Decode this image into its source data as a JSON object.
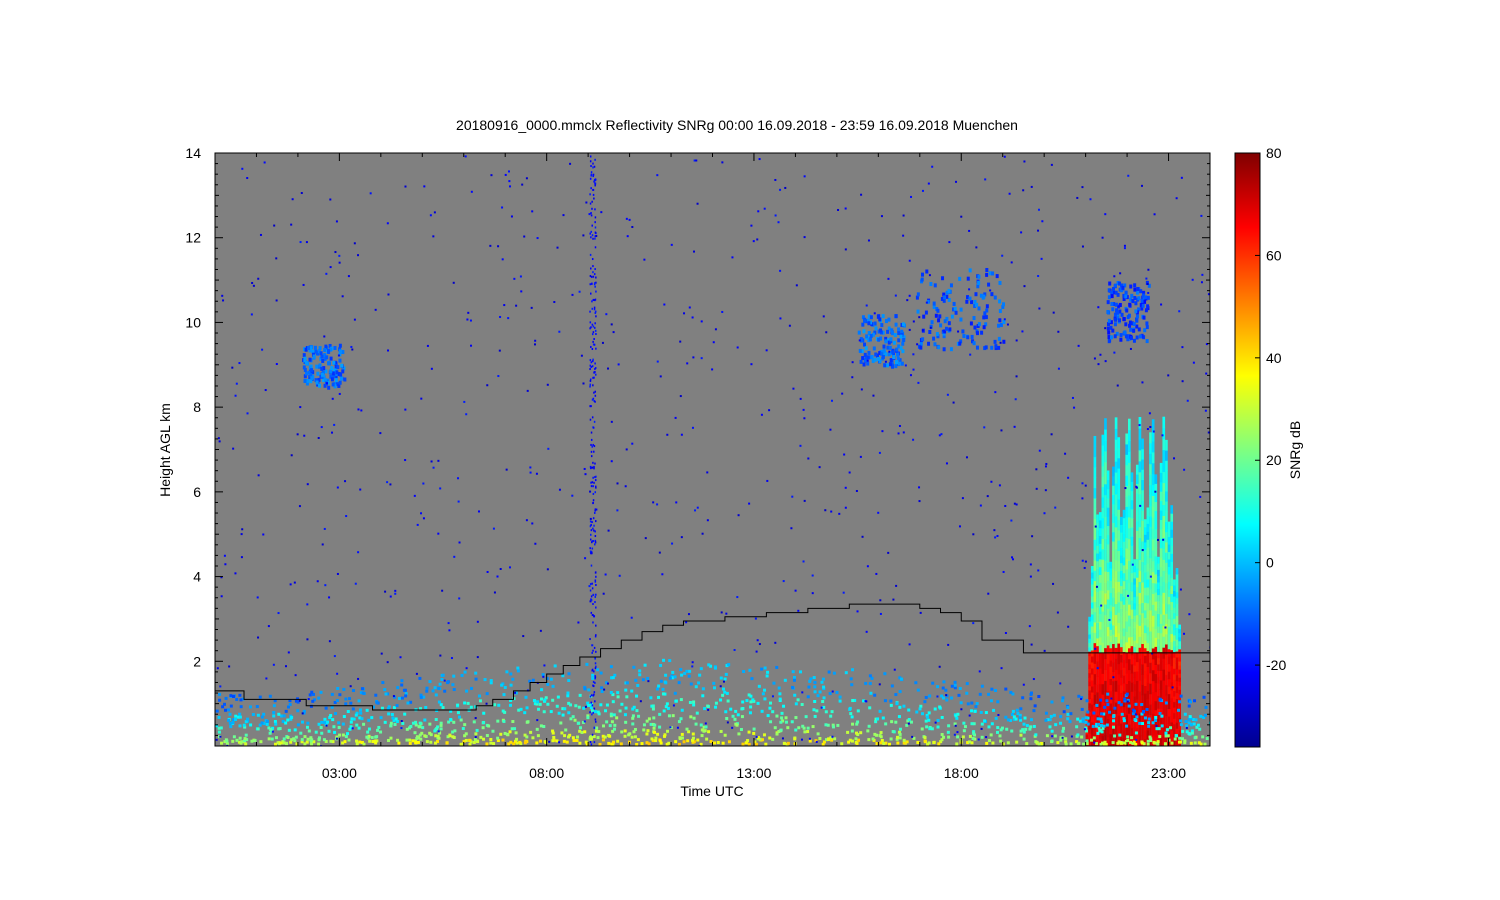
{
  "chart_data": {
    "type": "heatmap",
    "title": "20180916_0000.mmclx Reflectivity SNRg   00:00 16.09.2018 - 23:59 16.09.2018 Muenchen",
    "xlabel": "Time UTC",
    "ylabel": "Height AGL km",
    "x_range_hours": [
      0,
      24
    ],
    "ylim": [
      0,
      14
    ],
    "x_ticks": [
      {
        "hours": 3,
        "label": "03:00"
      },
      {
        "hours": 8,
        "label": "08:00"
      },
      {
        "hours": 13,
        "label": "13:00"
      },
      {
        "hours": 18,
        "label": "18:00"
      },
      {
        "hours": 23,
        "label": "23:00"
      }
    ],
    "y_ticks": [
      2,
      4,
      6,
      8,
      10,
      12,
      14
    ],
    "background_color": "#808080",
    "colorbar": {
      "label": "SNRg dB",
      "range": [
        -36,
        80
      ],
      "ticks": [
        -20,
        0,
        20,
        40,
        60,
        80
      ],
      "colormap": "jet"
    },
    "black_line_km": [
      [
        0.0,
        1.3
      ],
      [
        0.7,
        1.1
      ],
      [
        2.2,
        0.95
      ],
      [
        3.8,
        0.85
      ],
      [
        6.3,
        0.95
      ],
      [
        6.7,
        1.1
      ],
      [
        7.2,
        1.3
      ],
      [
        7.6,
        1.5
      ],
      [
        8.0,
        1.7
      ],
      [
        8.4,
        1.9
      ],
      [
        8.8,
        2.1
      ],
      [
        9.3,
        2.3
      ],
      [
        9.8,
        2.5
      ],
      [
        10.3,
        2.7
      ],
      [
        10.8,
        2.85
      ],
      [
        11.3,
        2.95
      ],
      [
        12.3,
        3.05
      ],
      [
        13.3,
        3.15
      ],
      [
        14.3,
        3.25
      ],
      [
        15.3,
        3.35
      ],
      [
        16.3,
        3.35
      ],
      [
        17.0,
        3.25
      ],
      [
        17.5,
        3.15
      ],
      [
        18.0,
        2.95
      ],
      [
        18.5,
        2.5
      ],
      [
        19.5,
        2.2
      ],
      [
        21.5,
        2.2
      ],
      [
        23.0,
        2.2
      ],
      [
        24.0,
        2.2
      ]
    ],
    "features": [
      {
        "type": "cirrus",
        "t_start": 2.1,
        "t_end": 3.1,
        "h_low": 8.5,
        "h_high": 9.5,
        "snr_db": -10
      },
      {
        "type": "cirrus",
        "t_start": 15.5,
        "t_end": 16.6,
        "h_low": 9.0,
        "h_high": 10.2,
        "snr_db": -10
      },
      {
        "type": "cirrus",
        "t_start": 16.9,
        "t_end": 19.0,
        "h_low": 9.4,
        "h_high": 11.3,
        "snr_db": -12
      },
      {
        "type": "cirrus",
        "t_start": 21.5,
        "t_end": 22.5,
        "h_low": 9.6,
        "h_high": 11.0,
        "snr_db": -14
      },
      {
        "type": "precipitation",
        "t_start": 21.0,
        "t_end": 23.3,
        "h_low": 0.0,
        "h_high": 7.8,
        "snr_db": 55
      },
      {
        "type": "boundary_layer",
        "t_start": 0.0,
        "t_end": 24.0,
        "h_low": 0.0,
        "h_high": 2.0,
        "snr_db": 5
      }
    ]
  }
}
